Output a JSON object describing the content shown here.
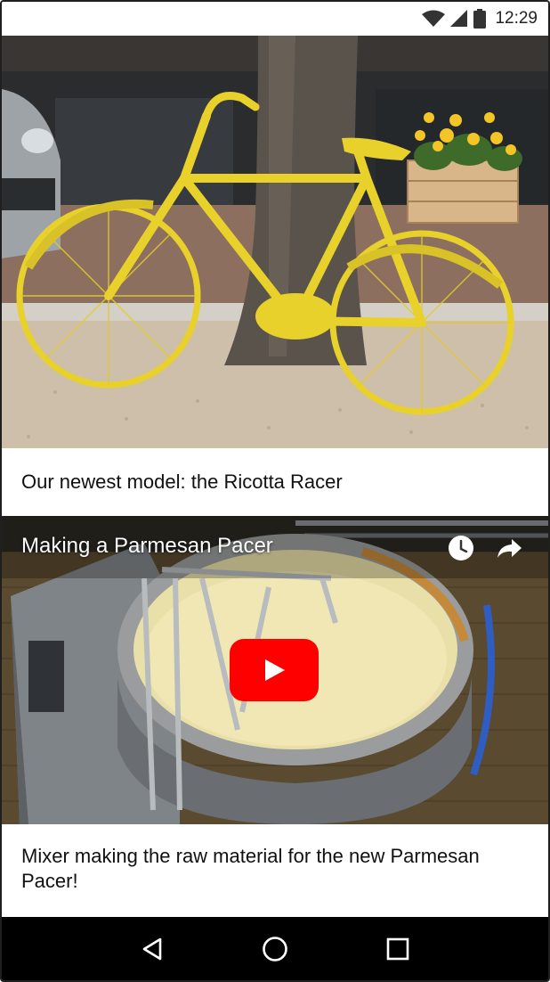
{
  "status_bar": {
    "time": "12:29",
    "icons": [
      "wifi-icon",
      "cell-signal-icon",
      "battery-icon"
    ]
  },
  "feed": {
    "cards": [
      {
        "type": "image",
        "caption": "Our newest model: the Ricotta Racer"
      },
      {
        "type": "video",
        "video_title": "Making a Parmesan Pacer",
        "controls": [
          "watch-later-icon",
          "share-icon"
        ],
        "play_icon": "play-icon",
        "caption": "Mixer making the raw material for the new Parmesan Pacer!"
      }
    ]
  },
  "nav_bar": {
    "buttons": [
      "back-icon",
      "home-icon",
      "recents-icon"
    ]
  },
  "colors": {
    "play_button": "#ff0000",
    "nav_bar_bg": "#000000",
    "bike_yellow": "#e8d12a"
  }
}
